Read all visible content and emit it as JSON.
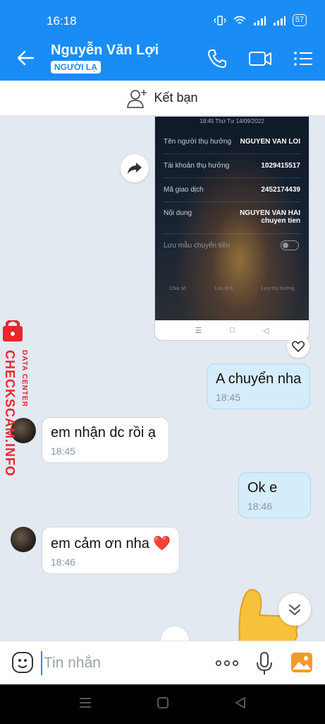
{
  "status_bar": {
    "time": "16:18",
    "battery": "57"
  },
  "header": {
    "contact_name": "Nguyễn Văn Lợi",
    "badge": "NGƯỜI LẠ"
  },
  "add_friend": {
    "label": "Kết bạn"
  },
  "shared_image": {
    "meta": "18:45 Thứ Tư 14/09/2022",
    "rows": [
      {
        "label": "Tên người thụ hưởng",
        "value": "NGUYEN VAN LOI"
      },
      {
        "label": "Tài khoản thụ hưởng",
        "value": "1029415517"
      },
      {
        "label": "Mã giao dịch",
        "value": "2452174439"
      },
      {
        "label": "Nội dung",
        "value": "NGUYEN VAN HAI",
        "value2": "chuyen tien"
      }
    ],
    "toggle_label": "Lưu mẫu chuyển tiền",
    "actions": [
      "Chia sẻ",
      "Lưu ảnh",
      "Lưu thụ hưởng"
    ]
  },
  "messages": [
    {
      "direction": "out",
      "text": "A chuyển nha",
      "time": "18:45"
    },
    {
      "direction": "in",
      "text": "em nhận dc rồi ạ",
      "time": "18:45"
    },
    {
      "direction": "out",
      "text": "Ok e",
      "time": "18:46"
    },
    {
      "direction": "in",
      "text": "em cảm ơn nha ❤️",
      "time": "18:46"
    }
  ],
  "watermark": {
    "line1": "DATA CENTER",
    "line2": "CHECKSCAM.INFO"
  },
  "input": {
    "placeholder": "Tin nhắn"
  },
  "colors": {
    "accent": "#1a8cf5",
    "outgoing_bubble": "#d5ecfb",
    "watermark_red": "#e8262b"
  },
  "icons": [
    "back-arrow-icon",
    "phone-icon",
    "video-call-icon",
    "menu-list-icon",
    "add-friend-icon",
    "share-forward-icon",
    "heart-icon",
    "emoji-icon",
    "more-dots-icon",
    "microphone-icon",
    "image-icon",
    "chevron-double-down-icon"
  ]
}
